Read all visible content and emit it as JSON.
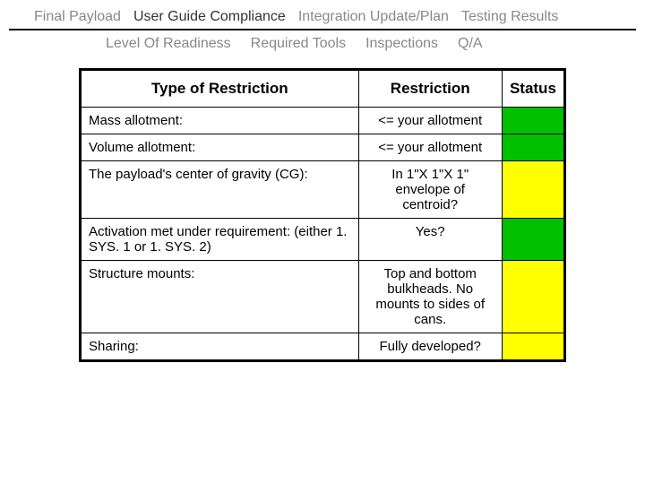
{
  "tabs_row1": [
    {
      "label": "Final Payload",
      "active": false
    },
    {
      "label": "User Guide Compliance",
      "active": true
    },
    {
      "label": "Integration Update/Plan",
      "active": false
    },
    {
      "label": "Testing Results",
      "active": false
    }
  ],
  "tabs_row2": [
    {
      "label": "Level Of Readiness",
      "active": false
    },
    {
      "label": "Required Tools",
      "active": false
    },
    {
      "label": "Inspections",
      "active": false
    },
    {
      "label": "Q/A",
      "active": false
    }
  ],
  "table": {
    "headers": [
      "Type of Restriction",
      "Restriction",
      "Status"
    ],
    "rows": [
      {
        "type": "Mass allotment:",
        "restriction": "<= your allotment",
        "status": "green"
      },
      {
        "type": "Volume allotment:",
        "restriction": "<= your allotment",
        "status": "green"
      },
      {
        "type": "The payload's center of gravity (CG):",
        "restriction": "In 1\"X 1\"X 1\" envelope of centroid?",
        "status": "yellow"
      },
      {
        "type": "Activation met under requirement: (either 1. SYS. 1 or 1. SYS. 2)",
        "restriction": "Yes?",
        "status": "green"
      },
      {
        "type": "Structure mounts:",
        "restriction": "Top and bottom bulkheads. No mounts to sides of cans.",
        "status": "yellow"
      },
      {
        "type": "Sharing:",
        "restriction": "Fully developed?",
        "status": "yellow"
      }
    ]
  }
}
